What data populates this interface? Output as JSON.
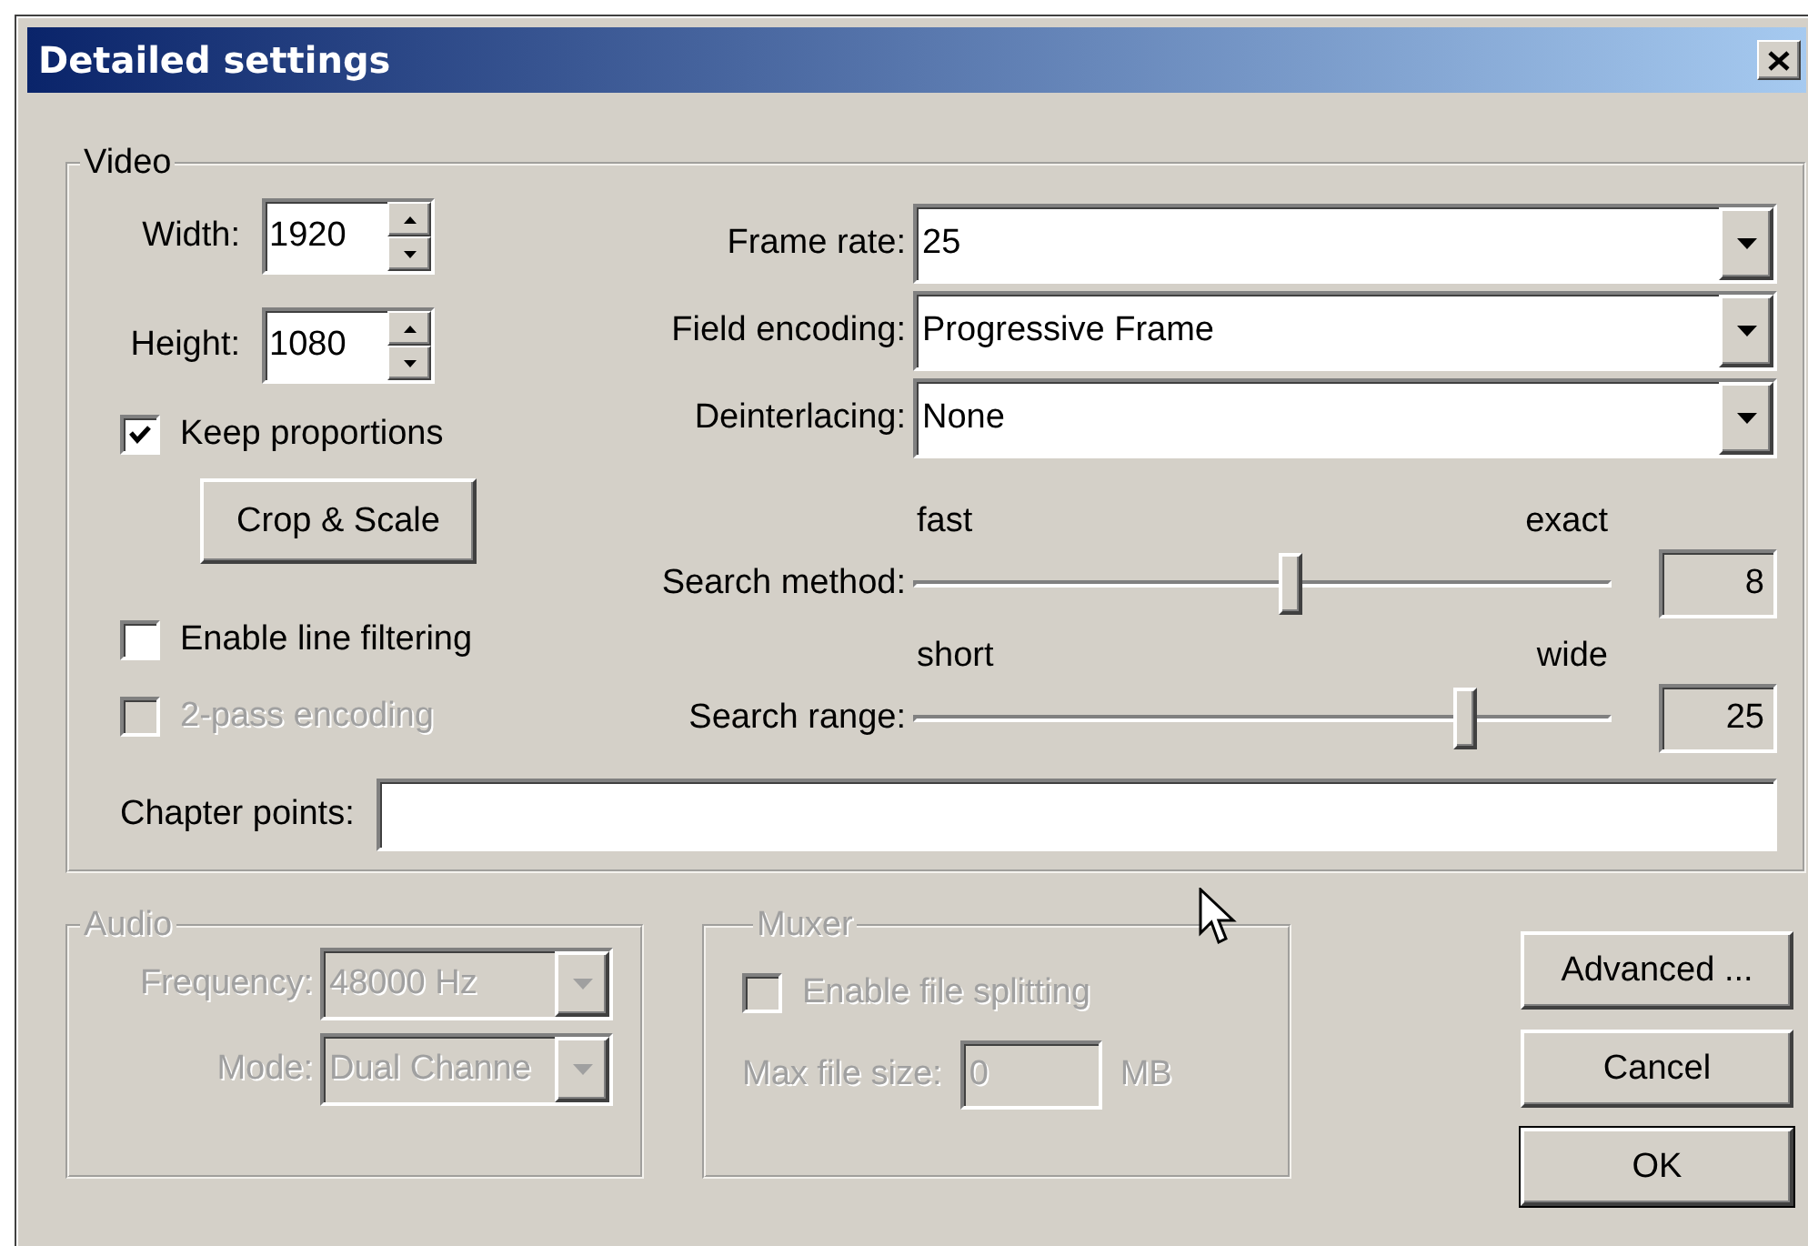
{
  "window": {
    "title": "Detailed settings"
  },
  "video": {
    "title": "Video",
    "width": {
      "label": "Width:",
      "value": "1920"
    },
    "height": {
      "label": "Height:",
      "value": "1080"
    },
    "keep_proportions": {
      "label": "Keep proportions",
      "checked": true,
      "disabled": false
    },
    "crop_button": {
      "label": "Crop & Scale"
    },
    "line_filtering": {
      "label": "Enable line filtering",
      "checked": false,
      "disabled": false
    },
    "two_pass": {
      "label": "2-pass encoding",
      "checked": false,
      "disabled": true
    },
    "frame_rate": {
      "label": "Frame rate:",
      "value": "25"
    },
    "field_encoding": {
      "label": "Field encoding:",
      "value": "Progressive Frame"
    },
    "deinterlacing": {
      "label": "Deinterlacing:",
      "value": "None"
    },
    "search_method": {
      "label": "Search method:",
      "min_label": "fast",
      "max_label": "exact",
      "level": 0.54,
      "reading": "8"
    },
    "search_range": {
      "label": "Search range:",
      "min_label": "short",
      "max_label": "wide",
      "level": 0.79,
      "reading": "25"
    },
    "chapter_points": {
      "label": "Chapter points:"
    }
  },
  "audio": {
    "title": "Audio",
    "disabled": true,
    "frequency": {
      "label": "Frequency:",
      "value": "48000 Hz"
    },
    "mode": {
      "label": "Mode:",
      "value": "Dual Channe"
    }
  },
  "muxer": {
    "title": "Muxer",
    "disabled": true,
    "file_splitting": {
      "label": "Enable file splitting",
      "checked": false
    },
    "max_file_size": {
      "label": "Max file size:",
      "value": "0",
      "unit": "MB"
    }
  },
  "buttons": [
    {
      "label": "Advanced ...",
      "default": false
    },
    {
      "label": "Cancel",
      "default": false
    },
    {
      "label": "OK",
      "default": true
    }
  ]
}
